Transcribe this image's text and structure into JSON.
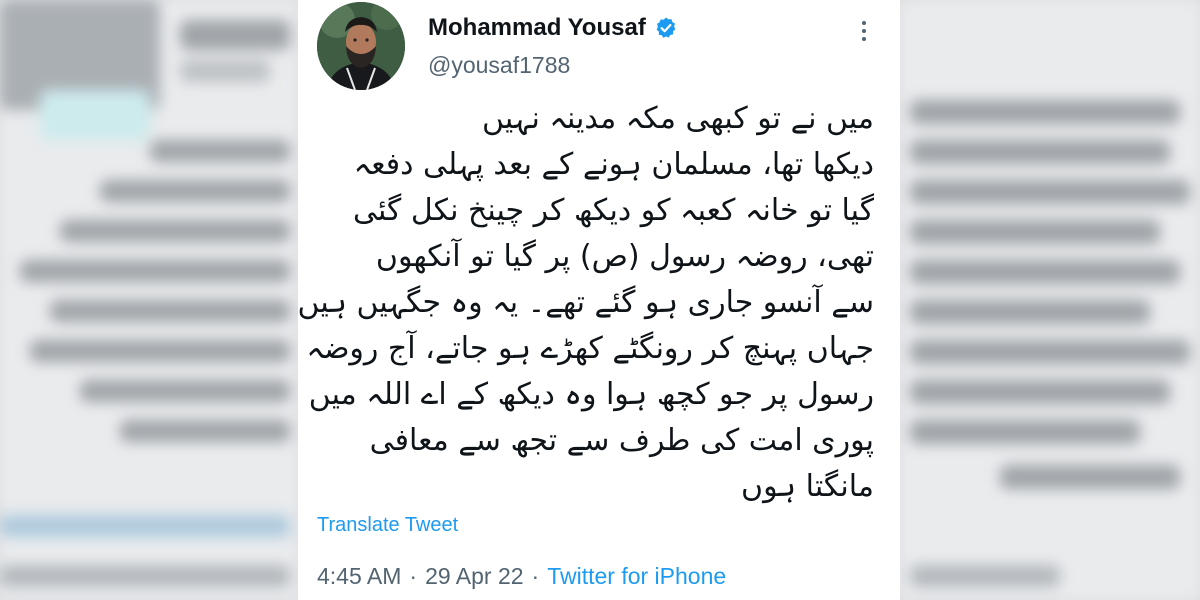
{
  "tweet": {
    "display_name": "Mohammad Yousaf",
    "handle": "@yousaf1788",
    "verified_icon": "verified-badge-icon",
    "more_icon": "more-options-icon",
    "text_lines": [
      "میں نے تو کبھی مکہ مدینہ نہیں",
      "دیکھا تھا، مسلمان ہونے کے بعد پہلی دفعہ",
      "گیا تو خانہ کعبہ کو دیکھ کر چینخ نکل گئی",
      "تھی، روضہ رسول (ص) پر گیا تو آنکھوں",
      "سے آنسو جاری ہو گئے تھے۔ یہ وہ جگہیں ہیں",
      "جہاں پہنچ کر رونگٹے کھڑے ہو جاتے، آج روضہ",
      "رسول پر جو کچھ ہوا وہ دیکھ کے اے اللہ میں",
      "پوری امت کی طرف سے تجھ سے معافی",
      "مانگتا ہوں"
    ],
    "translate_label": "Translate Tweet",
    "time": "4:45 AM",
    "separator": "·",
    "date": "29 Apr 22",
    "source": "Twitter for iPhone"
  },
  "colors": {
    "accent": "#1d9bf0",
    "text": "#0f1419",
    "secondary": "#536471"
  }
}
